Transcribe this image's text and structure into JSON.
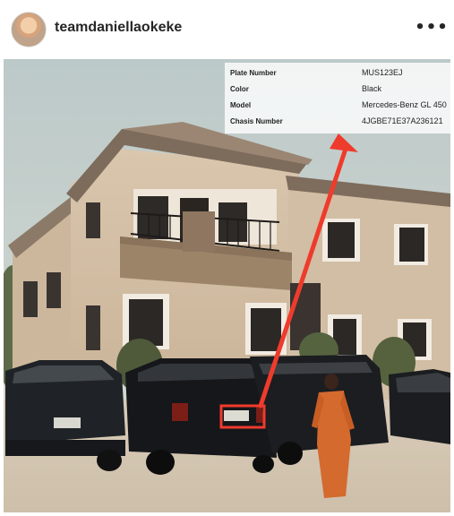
{
  "post": {
    "username": "teamdaniellaokeke",
    "more_icon": "more-horizontal-icon",
    "more_glyph": "•••"
  },
  "vehicle_info": {
    "rows": [
      {
        "label": "Plate Number",
        "value": "MUS123EJ"
      },
      {
        "label": "Color",
        "value": "Black"
      },
      {
        "label": "Model",
        "value": "Mercedes-Benz GL 450"
      },
      {
        "label": "Chasis Number",
        "value": "4JGBE71E37A236121"
      }
    ]
  },
  "photo": {
    "plate_text": "MUS123EJ",
    "annotation_color": "#ef3b2c"
  }
}
